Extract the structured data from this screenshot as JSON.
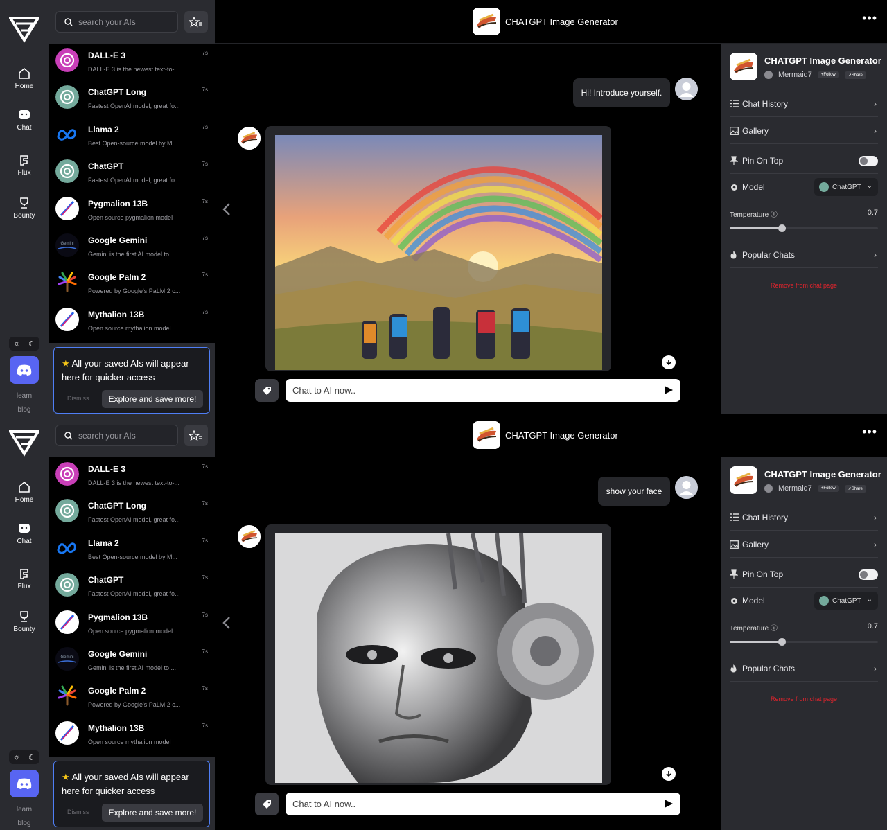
{
  "frames": [
    {
      "rail": {
        "nav": [
          {
            "label": "Home"
          },
          {
            "label": "Chat"
          },
          {
            "label": "Flux"
          },
          {
            "label": "Bounty"
          }
        ],
        "learn": "learn",
        "blog": "blog"
      },
      "search": {
        "placeholder": "search your AIs"
      },
      "ai_list": [
        {
          "name": "DALL-E 3",
          "desc": "DALL-E 3 is the newest text-to-...",
          "time": "7s",
          "icon": "openai-pink"
        },
        {
          "name": "ChatGPT Long",
          "desc": "Fastest OpenAI model, great fo...",
          "time": "7s",
          "icon": "openai-green"
        },
        {
          "name": "Llama 2",
          "desc": "Best Open-source model by M...",
          "time": "7s",
          "icon": "meta"
        },
        {
          "name": "ChatGPT",
          "desc": "Fastest OpenAI model, great fo...",
          "time": "7s",
          "icon": "openai-green"
        },
        {
          "name": "Pygmalion 13B",
          "desc": "Open source pygmalion model",
          "time": "7s",
          "icon": "quill"
        },
        {
          "name": "Google Gemini",
          "desc": "Gemini is the first AI model to ...",
          "time": "7s",
          "icon": "gemini"
        },
        {
          "name": "Google Palm 2",
          "desc": "Powered by Google's PaLM 2 c...",
          "time": "7s",
          "icon": "palm"
        },
        {
          "name": "Mythalion 13B",
          "desc": "Open source mythalion model",
          "time": "7s",
          "icon": "quill"
        }
      ],
      "saved_card": {
        "message": "All your saved AIs will appear here for quicker access",
        "dismiss": "Dismiss",
        "explore": "Explore and save more!"
      },
      "header": {
        "title": "CHATGPT Image Generator",
        "more": "•••"
      },
      "chat": {
        "user_message": "Hi! Introduce yourself.",
        "image_subject": "rainbow-hikers",
        "input_placeholder": "Chat to AI now.."
      },
      "panel": {
        "title": "CHATGPT Image Generator",
        "author": "Mermaid7",
        "follow": "+Follow",
        "share": "↗Share",
        "chat_history": "Chat History",
        "gallery": "Gallery",
        "pin_on_top": "Pin On Top",
        "pin_on_top_enabled": false,
        "model": "Model",
        "model_value": "ChatGPT",
        "temperature_label": "Temperature",
        "temperature_value": "0.7",
        "temperature_fraction": 0.35,
        "popular_chats": "Popular Chats",
        "remove": "Remove from chat page"
      }
    },
    {
      "rail": {
        "nav": [
          {
            "label": "Home"
          },
          {
            "label": "Chat"
          },
          {
            "label": "Flux"
          },
          {
            "label": "Bounty"
          }
        ],
        "learn": "learn",
        "blog": "blog"
      },
      "search": {
        "placeholder": "search your AIs"
      },
      "ai_list": [
        {
          "name": "DALL-E 3",
          "desc": "DALL-E 3 is the newest text-to-...",
          "time": "7s",
          "icon": "openai-pink"
        },
        {
          "name": "ChatGPT Long",
          "desc": "Fastest OpenAI model, great fo...",
          "time": "7s",
          "icon": "openai-green"
        },
        {
          "name": "Llama 2",
          "desc": "Best Open-source model by M...",
          "time": "7s",
          "icon": "meta"
        },
        {
          "name": "ChatGPT",
          "desc": "Fastest OpenAI model, great fo...",
          "time": "7s",
          "icon": "openai-green"
        },
        {
          "name": "Pygmalion 13B",
          "desc": "Open source pygmalion model",
          "time": "7s",
          "icon": "quill"
        },
        {
          "name": "Google Gemini",
          "desc": "Gemini is the first AI model to ...",
          "time": "7s",
          "icon": "gemini"
        },
        {
          "name": "Google Palm 2",
          "desc": "Powered by Google's PaLM 2 c...",
          "time": "7s",
          "icon": "palm"
        },
        {
          "name": "Mythalion 13B",
          "desc": "Open source mythalion model",
          "time": "7s",
          "icon": "quill"
        }
      ],
      "saved_card": {
        "message": "All your saved AIs will appear here for quicker access",
        "dismiss": "Dismiss",
        "explore": "Explore and save more!"
      },
      "header": {
        "title": "CHATGPT Image Generator",
        "more": "•••"
      },
      "chat": {
        "user_message": "show your face",
        "image_subject": "chrome-robot-face",
        "input_placeholder": "Chat to AI now.."
      },
      "panel": {
        "title": "CHATGPT Image Generator",
        "author": "Mermaid7",
        "follow": "+Follow",
        "share": "↗Share",
        "chat_history": "Chat History",
        "gallery": "Gallery",
        "pin_on_top": "Pin On Top",
        "pin_on_top_enabled": false,
        "model": "Model",
        "model_value": "ChatGPT",
        "temperature_label": "Temperature",
        "temperature_value": "0.7",
        "temperature_fraction": 0.35,
        "popular_chats": "Popular Chats",
        "remove": "Remove from chat page"
      }
    }
  ],
  "colors": {
    "rail_bg": "#2a2b30",
    "accent_blue": "#4f7ef5",
    "discord": "#5865f2",
    "danger": "#e0242d",
    "openai_green": "#74aa9c"
  }
}
